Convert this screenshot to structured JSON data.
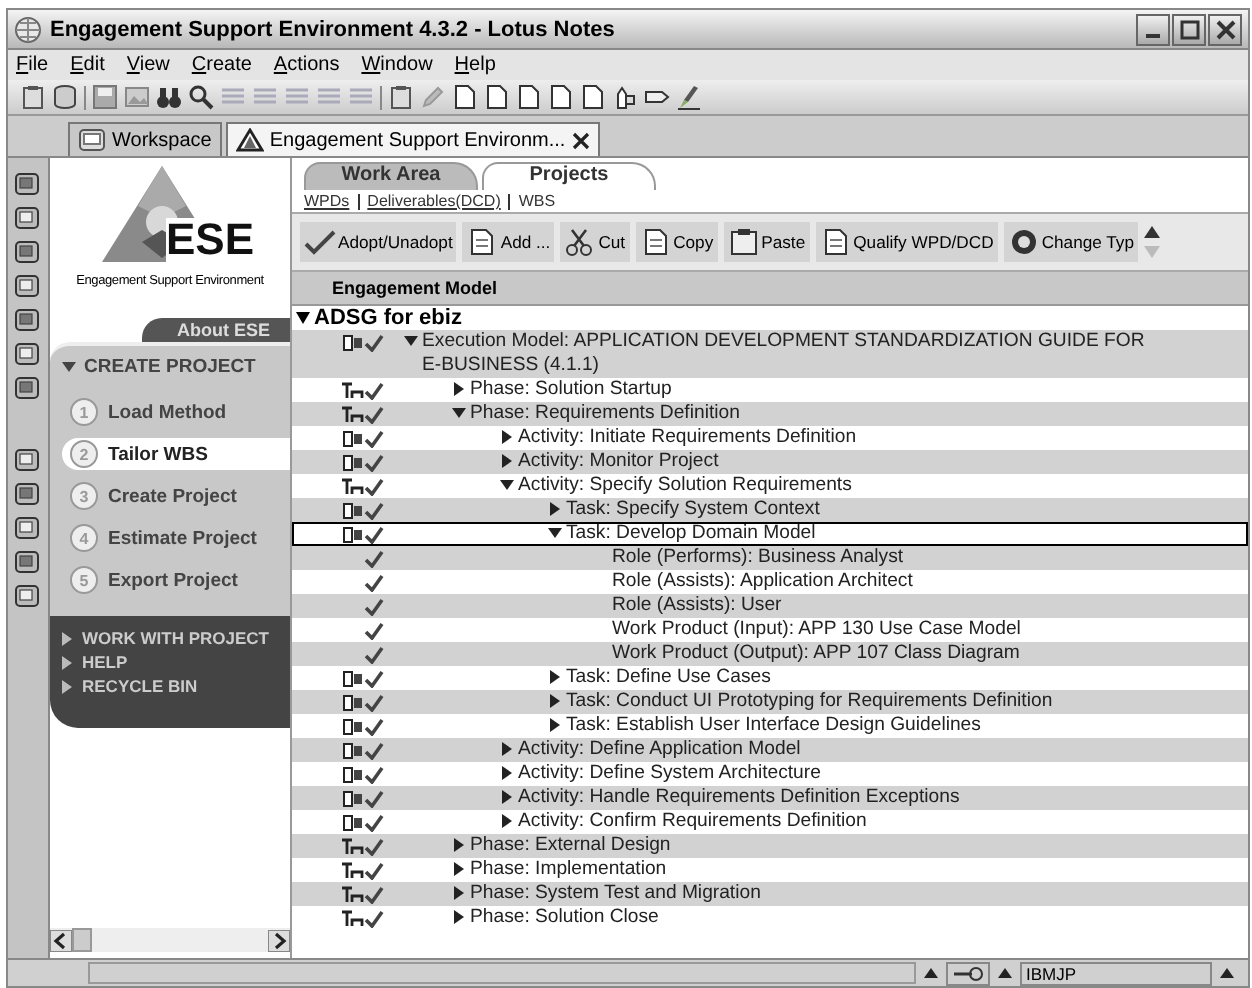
{
  "window": {
    "title": "Engagement Support Environment 4.3.2 - Lotus Notes"
  },
  "menu": [
    "File",
    "Edit",
    "View",
    "Create",
    "Actions",
    "Window",
    "Help"
  ],
  "workspace_tabs": [
    {
      "label": "Workspace",
      "selected": false
    },
    {
      "label": "Engagement Support Environm...",
      "selected": true
    }
  ],
  "sidebar": {
    "logo_text": "ESE",
    "logo_caption": "Engagement Support Environment",
    "about": "About ESE",
    "section": {
      "title": "CREATE PROJECT",
      "expanded": true
    },
    "steps": [
      {
        "number": "1",
        "label": "Load Method",
        "selected": false
      },
      {
        "number": "2",
        "label": "Tailor WBS",
        "selected": true
      },
      {
        "number": "3",
        "label": "Create Project",
        "selected": false
      },
      {
        "number": "4",
        "label": "Estimate Project",
        "selected": false
      },
      {
        "number": "5",
        "label": "Export Project",
        "selected": false
      }
    ],
    "links": [
      "WORK WITH PROJECT",
      "HELP",
      "RECYCLE BIN"
    ]
  },
  "view_tabs": [
    {
      "label": "Work Area",
      "selected": false
    },
    {
      "label": "Projects",
      "selected": true
    }
  ],
  "view_links": [
    {
      "label": "WPDs",
      "selected": false
    },
    {
      "label": "Deliverables(DCD)",
      "selected": false
    },
    {
      "label": "WBS",
      "selected": true
    }
  ],
  "actions": [
    "Adopt/Unadopt",
    "Add ...",
    "Cut",
    "Copy",
    "Paste",
    "Qualify WPD/DCD",
    "Change Typ"
  ],
  "column_header": "Engagement Model",
  "tree": {
    "root": {
      "label": "ADSG for ebiz",
      "expanded": true,
      "children": [
        {
          "kind": "package",
          "label": "Execution Model: APPLICATION DEVELOPMENT STANDARDIZATION GUIDE FOR E-BUSINESS (4.1.1)",
          "expanded": true,
          "selected": false,
          "children": [
            {
              "kind": "team",
              "label": "Phase: Solution Startup",
              "expanded": false,
              "selected": false
            },
            {
              "kind": "team",
              "label": "Phase: Requirements Definition",
              "expanded": true,
              "selected": false,
              "children": [
                {
                  "kind": "package",
                  "label": "Activity: Initiate Requirements Definition",
                  "expanded": false,
                  "selected": false
                },
                {
                  "kind": "package",
                  "label": "Activity: Monitor Project",
                  "expanded": false,
                  "selected": false
                },
                {
                  "kind": "team",
                  "label": "Activity: Specify Solution Requirements",
                  "expanded": true,
                  "selected": false,
                  "children": [
                    {
                      "kind": "package",
                      "label": "Task: Specify System Context",
                      "expanded": false,
                      "selected": false
                    },
                    {
                      "kind": "package",
                      "label": "Task: Develop Domain Model",
                      "expanded": true,
                      "selected": true,
                      "children": [
                        {
                          "kind": "item",
                          "label": "Role (Performs): Business Analyst",
                          "selected": false
                        },
                        {
                          "kind": "item",
                          "label": "Role (Assists): Application Architect",
                          "selected": false
                        },
                        {
                          "kind": "item",
                          "label": "Role (Assists): User",
                          "selected": false
                        },
                        {
                          "kind": "item",
                          "label": "Work Product (Input): APP 130 Use Case Model",
                          "selected": false
                        },
                        {
                          "kind": "item",
                          "label": "Work Product (Output): APP 107 Class Diagram",
                          "selected": false
                        }
                      ]
                    },
                    {
                      "kind": "package",
                      "label": "Task: Define Use Cases",
                      "expanded": false,
                      "selected": false
                    },
                    {
                      "kind": "package",
                      "label": "Task: Conduct UI Prototyping for Requirements Definition",
                      "expanded": false,
                      "selected": false
                    },
                    {
                      "kind": "package",
                      "label": "Task: Establish User Interface Design Guidelines",
                      "expanded": false,
                      "selected": false
                    }
                  ]
                },
                {
                  "kind": "package",
                  "label": "Activity: Define Application Model",
                  "expanded": false,
                  "selected": false
                },
                {
                  "kind": "package",
                  "label": "Activity: Define System Architecture",
                  "expanded": false,
                  "selected": false
                },
                {
                  "kind": "package",
                  "label": "Activity: Handle Requirements Definition Exceptions",
                  "expanded": false,
                  "selected": false
                },
                {
                  "kind": "package",
                  "label": "Activity: Confirm Requirements Definition",
                  "expanded": false,
                  "selected": false
                }
              ]
            },
            {
              "kind": "team",
              "label": "Phase: External Design",
              "expanded": false,
              "selected": false
            },
            {
              "kind": "team",
              "label": "Phase: Implementation",
              "expanded": false,
              "selected": false
            },
            {
              "kind": "team",
              "label": "Phase: System Test and Migration",
              "expanded": false,
              "selected": false
            },
            {
              "kind": "team",
              "label": "Phase: Solution Close",
              "expanded": false,
              "selected": false
            }
          ]
        }
      ]
    }
  },
  "status_bar": {
    "location": "IBMJP"
  }
}
